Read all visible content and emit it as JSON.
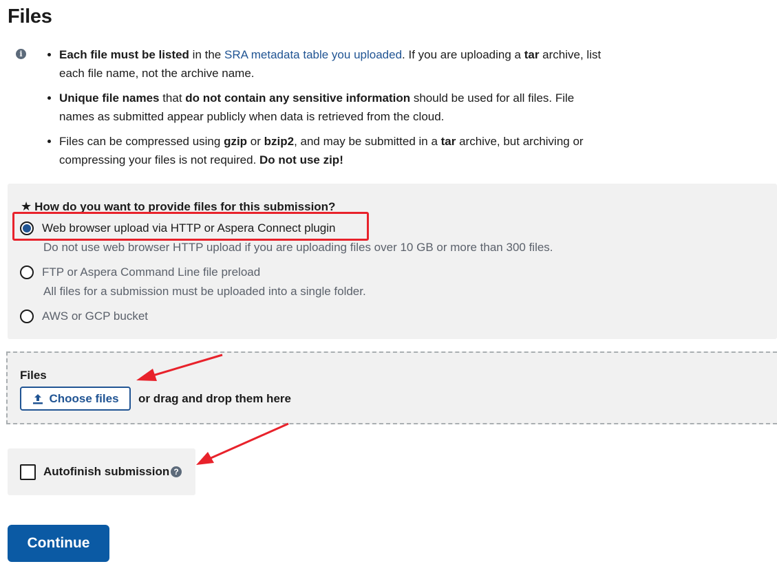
{
  "page": {
    "title": "Files"
  },
  "info": {
    "bullets": [
      {
        "p1": "Each file must be listed",
        "p2": " in the ",
        "link": "SRA metadata table you uploaded",
        "p3": ". If you are uploading a ",
        "p4": "tar",
        "p5": " archive, list each file name, not the archive name."
      },
      {
        "p1": "Unique file names",
        "p2": " that ",
        "p3": "do not contain any sensitive information",
        "p4": " should be used for all files. File names as submitted appear publicly when data is retrieved from the cloud."
      },
      {
        "p1": "Files can be compressed using ",
        "p2": "gzip",
        "p3": " or ",
        "p4": "bzip2",
        "p5": ", and may be submitted in a ",
        "p6": "tar",
        "p7": " archive, but archiving or compressing your files is not required. ",
        "p8": "Do not use zip!"
      }
    ]
  },
  "upload_method": {
    "required_marker": "★",
    "question": "How do you want to provide files for this submission?",
    "options": [
      {
        "label": "Web browser upload via HTTP or Aspera Connect plugin",
        "hint": "Do not use web browser HTTP upload if you are uploading files over 10 GB or more than 300 files.",
        "selected": true
      },
      {
        "label": "FTP or Aspera Command Line file preload",
        "hint": "All files for a submission must be uploaded into a single folder.",
        "selected": false
      },
      {
        "label": "AWS or GCP bucket",
        "hint": "",
        "selected": false
      }
    ]
  },
  "dropzone": {
    "label": "Files",
    "button_label": "Choose files",
    "drag_text": "or drag and drop them here"
  },
  "autofinish": {
    "label": "Autofinish submission",
    "help_glyph": "?",
    "checked": false
  },
  "actions": {
    "continue_label": "Continue"
  },
  "colors": {
    "link": "#205493",
    "primary_button": "#0b5aa4",
    "panel_bg": "#f1f1f1",
    "annotation_red": "#e8222b"
  }
}
